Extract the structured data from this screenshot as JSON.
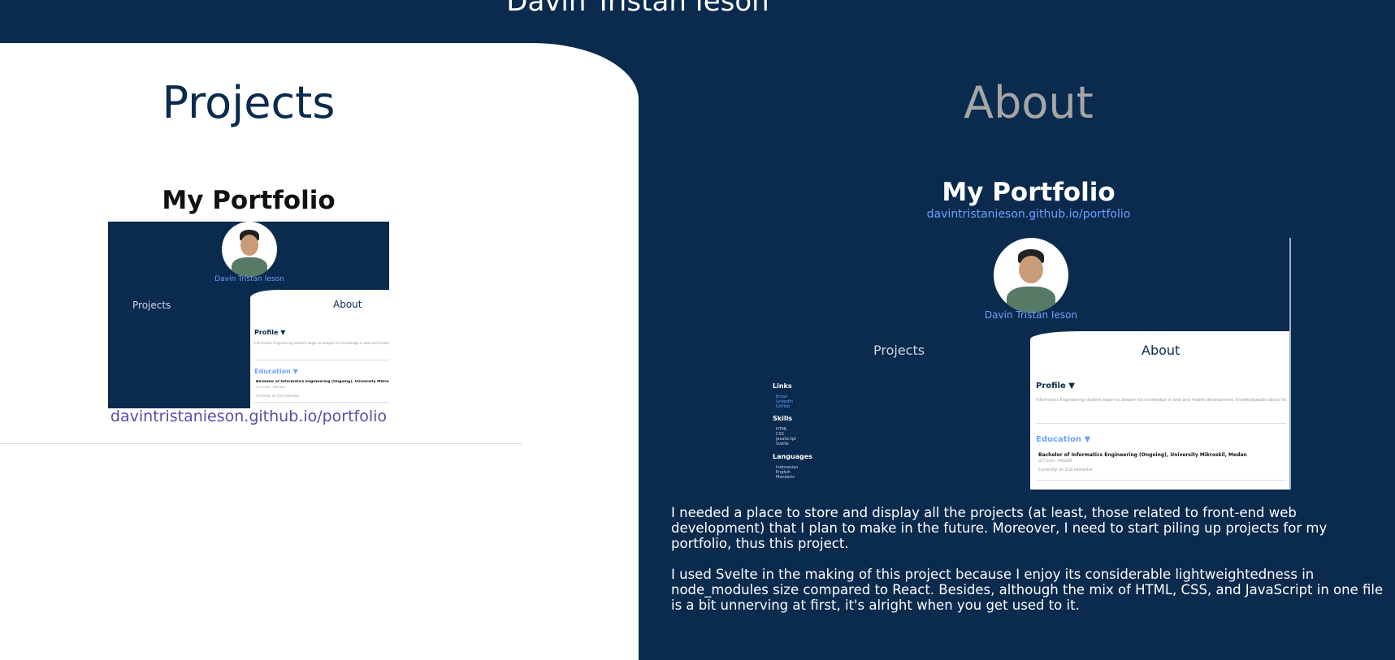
{
  "site": {
    "title": "Davin Tristan Ieson"
  },
  "tabs": {
    "projects": "Projects",
    "about": "About"
  },
  "project": {
    "title": "My Portfolio",
    "link": "davintristanieson.github.io/portfolio",
    "description": [
      "I needed a place to store and display all the projects (at least, those related to front-end web development) that I plan to make in the future. Moreover, I need to start piling up projects for my portfolio, thus this project.",
      "I used Svelte in the making of this project because I enjoy its considerable lightweightedness in node_modules size compared to React. Besides, although the mix of HTML, CSS, and JavaScript in one file is a bit unnerving at first, it's alright when you get used to it."
    ]
  },
  "preview": {
    "name": "Davin Tristan Ieson",
    "projects_tab": "Projects",
    "about_tab": "About",
    "profile_heading": "Profile ▼",
    "profile_text": "Informatics Engineering student eager to deepen his knowledge in web and mobile development. Knowledgeable about front-end web development and able to work well in a team. Likes experimenting with software in his spare time.",
    "education_heading": "Education ▼",
    "degree": "Bachelor of Informatics Engineering (Ongoing), University Mikroskil, Medan",
    "dates": "OCT 2020 - PRESENT",
    "semester": "Currently on 2nd semester",
    "links_heading": "Links",
    "links": [
      "Email",
      "LinkedIn",
      "GitHub"
    ],
    "skills_heading": "Skills",
    "skills": [
      "HTML",
      "CSS",
      "JavaScript",
      "Svelte"
    ],
    "languages_heading": "Languages",
    "languages": [
      "Indonesian",
      "English",
      "Mandarin"
    ]
  },
  "colors": {
    "navy": "#0a2a4e",
    "link": "#6fa0ff",
    "muted": "#a6a6a6"
  }
}
